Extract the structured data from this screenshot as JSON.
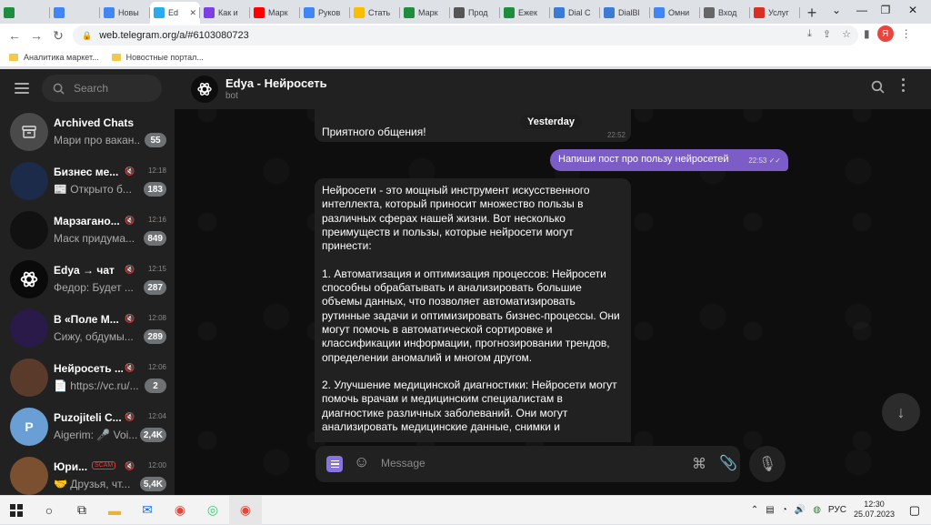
{
  "browser": {
    "tabs": [
      {
        "label": "",
        "icon": "green-plus-icon",
        "color": "#1e8e3e"
      },
      {
        "label": "",
        "icon": "google-drive-icon",
        "color": "#4285f4"
      },
      {
        "label": "Новы",
        "icon": "docs-icon",
        "color": "#4285f4"
      },
      {
        "label": "Ed",
        "icon": "telegram-icon",
        "color": "#2aabee",
        "active": true
      },
      {
        "label": "Как и",
        "icon": "s-icon",
        "color": "#7b3fe4"
      },
      {
        "label": "Марк",
        "icon": "youtube-icon",
        "color": "#ff0000"
      },
      {
        "label": "Руков",
        "icon": "docs-icon",
        "color": "#4285f4"
      },
      {
        "label": "Стать",
        "icon": "google-drive-icon",
        "color": "#fbbc04"
      },
      {
        "label": "Марк",
        "icon": "green-plus-icon",
        "color": "#1e8e3e"
      },
      {
        "label": "Прод",
        "icon": "translate-icon",
        "color": "#555555"
      },
      {
        "label": "Ежек",
        "icon": "green-plus-icon",
        "color": "#1e8e3e"
      },
      {
        "label": "Dial C",
        "icon": "dial-icon",
        "color": "#3a7bd5"
      },
      {
        "label": "DialBl",
        "icon": "dial-icon",
        "color": "#3a7bd5"
      },
      {
        "label": "Омни",
        "icon": "docs-icon",
        "color": "#4285f4"
      },
      {
        "label": "Вход",
        "icon": "login-icon",
        "color": "#666666"
      },
      {
        "label": "Услуг",
        "icon": "flag-icon",
        "color": "#d93025"
      }
    ],
    "new_tab": "+",
    "url": "web.telegram.org/a/#6103080723",
    "profile_letter": "Я",
    "bookmarks": [
      "Аналитика маркет...",
      "Новостные портал..."
    ]
  },
  "telegram": {
    "search_placeholder": "Search",
    "chats": [
      {
        "name": "Archived Chats",
        "preview": "Мари про вакан...",
        "badge": "55",
        "time": "",
        "avatar": "archive",
        "color": "#4a4a4a"
      },
      {
        "name": "Бизнес ме...",
        "preview": "📰 Открыто б...",
        "badge": "183",
        "time": "12:18",
        "muted": true,
        "color": "#1c2b4a"
      },
      {
        "name": "Марзагано...",
        "preview": "Маск придума...",
        "badge": "849",
        "time": "12:16",
        "muted": true,
        "color": "#111111"
      },
      {
        "name": "Edya → чат",
        "preview": "Федор: Будет ...",
        "badge": "287",
        "time": "12:15",
        "muted": true,
        "color": "#0a0a0a"
      },
      {
        "name": "В «Поле М...",
        "preview": "Сижу, обдумы...",
        "badge": "289",
        "time": "12:08",
        "muted": true,
        "color": "#2a1a4a"
      },
      {
        "name": "Нейросеть ...",
        "preview": "📄 https://vc.ru/...",
        "badge": "2",
        "time": "12:06",
        "muted": true,
        "color": "#5a3a2a"
      },
      {
        "name": "Puzojiteli C...",
        "preview": "Aigerim: 🎤 Voi...",
        "badge": "2,4K",
        "time": "12:04",
        "muted": true,
        "color": "#6a9fd6",
        "initial": "P"
      },
      {
        "name": "Юри...",
        "preview": "🤝 Друзья, чт...",
        "badge": "5,4K",
        "time": "12:00",
        "muted": true,
        "scam": "SCAM",
        "color": "#7a5030"
      }
    ],
    "chat_title": "Edya - Нейросеть",
    "chat_subtitle": "bot",
    "date_chip": "Yesterday",
    "messages": {
      "in1_text": "Приятного общения!",
      "in1_time": "22:52",
      "out_text": "Напиши пост про пользу нейросетей",
      "out_time": "22:53",
      "in2_text": "Нейросети - это мощный инструмент искусственного интеллекта, который приносит множество пользы в различных сферах нашей жизни. Вот несколько преимуществ и пользы, которые нейросети могут принести:\n\n1. Автоматизация и оптимизация процессов: Нейросети способны обрабатывать и анализировать большие объемы данных, что позволяет автоматизировать рутинные задачи и оптимизировать бизнес-процессы. Они могут помочь в автоматической сортировке и классификации информации, прогнозировании трендов, определении аномалий и многом другом.\n\n2. Улучшение медицинской диагностики: Нейросети могут помочь врачам и медицинским специалистам в диагностике различных заболеваний. Они могут анализировать медицинские данные, снимки и"
    },
    "composer_placeholder": "Message",
    "accent": "#8774e1"
  },
  "taskbar": {
    "lang": "РУС",
    "time": "12:30",
    "date": "25.07.2023"
  }
}
